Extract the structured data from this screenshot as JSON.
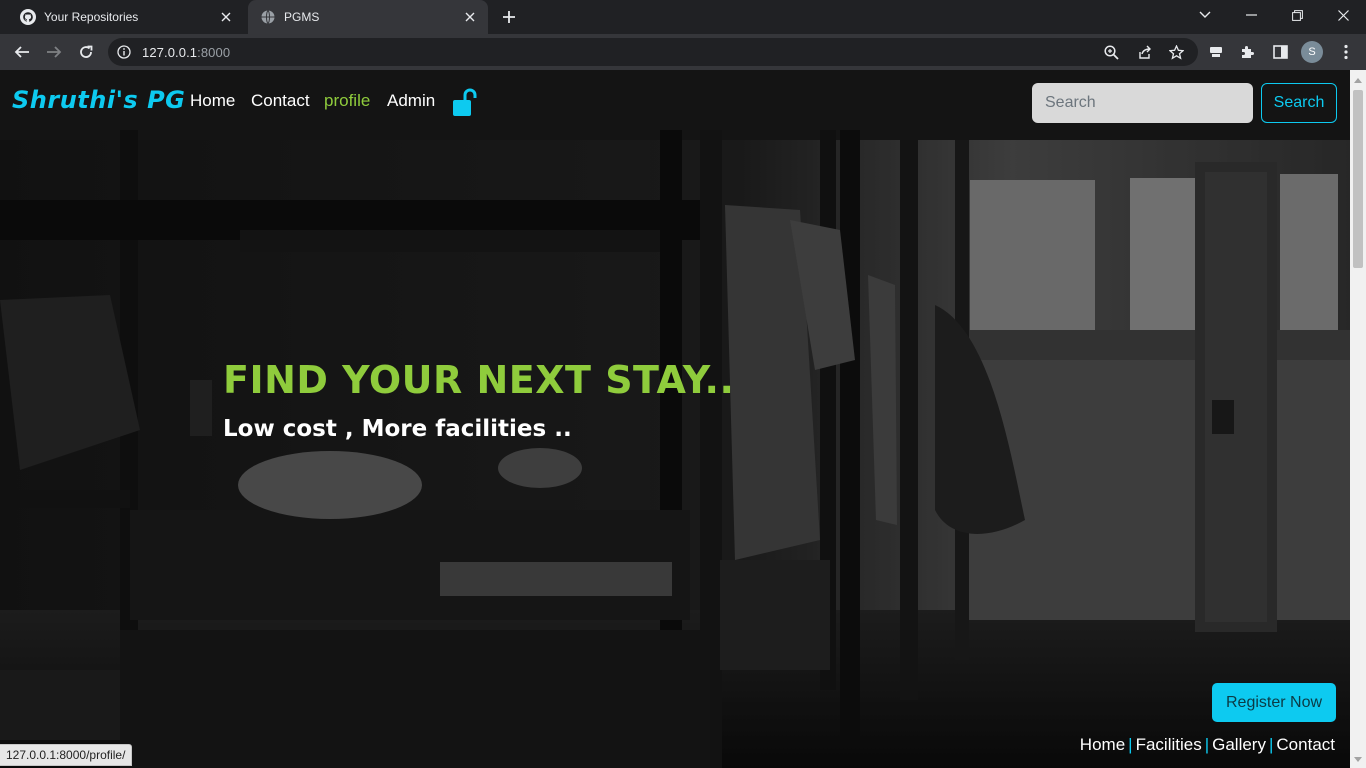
{
  "browser": {
    "tabs": [
      {
        "title": "Your Repositories",
        "icon": "github-icon",
        "active": false
      },
      {
        "title": "PGMS",
        "icon": "globe-icon",
        "active": true
      }
    ],
    "url_host": "127.0.0.1",
    "url_port": ":8000",
    "status_url": "127.0.0.1:8000/profile/",
    "profile_initial": "S"
  },
  "navbar": {
    "brand": "Shruthi's PG",
    "links": {
      "home": "Home",
      "contact": "Contact",
      "profile": "profile",
      "admin": "Admin"
    },
    "search_placeholder": "Search",
    "search_button": "Search"
  },
  "hero": {
    "title": "FIND YOUR NEXT STAY..",
    "subtitle": "Low cost , More facilities .."
  },
  "register_button": "Register Now",
  "footer": {
    "home": "Home",
    "facilities": "Facilities",
    "gallery": "Gallery",
    "contact": "Contact"
  },
  "colors": {
    "accent_cyan": "#0dcaf0",
    "accent_green": "#8fcc3c",
    "chrome_dark": "#202124",
    "chrome_toolbar": "#35363a"
  }
}
